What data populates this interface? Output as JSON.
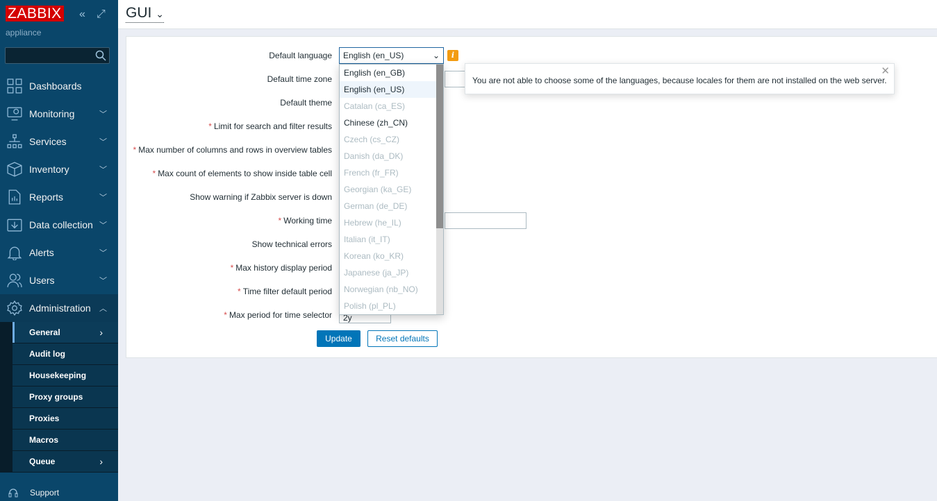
{
  "sidebar": {
    "logo": "ZABBIX",
    "subtitle": "appliance",
    "search_placeholder": "",
    "items": [
      {
        "label": "Dashboards",
        "icon": "dashboards-icon",
        "chevron": false
      },
      {
        "label": "Monitoring",
        "icon": "monitoring-icon",
        "chevron": true
      },
      {
        "label": "Services",
        "icon": "services-icon",
        "chevron": true
      },
      {
        "label": "Inventory",
        "icon": "inventory-icon",
        "chevron": true
      },
      {
        "label": "Reports",
        "icon": "reports-icon",
        "chevron": true
      },
      {
        "label": "Data collection",
        "icon": "data-collection-icon",
        "chevron": true
      },
      {
        "label": "Alerts",
        "icon": "alerts-icon",
        "chevron": true
      },
      {
        "label": "Users",
        "icon": "users-icon",
        "chevron": true
      },
      {
        "label": "Administration",
        "icon": "gear-icon",
        "chevron": true,
        "expanded": true
      }
    ],
    "submenu": [
      {
        "label": "General",
        "active": true,
        "arrow": true
      },
      {
        "label": "Audit log"
      },
      {
        "label": "Housekeeping"
      },
      {
        "label": "Proxy groups"
      },
      {
        "label": "Proxies"
      },
      {
        "label": "Macros"
      },
      {
        "label": "Queue",
        "arrow": true
      }
    ],
    "support": "Support"
  },
  "header": {
    "title": "GUI"
  },
  "form": {
    "fields": [
      {
        "label": "Default language",
        "required": false
      },
      {
        "label": "Default time zone",
        "required": false
      },
      {
        "label": "Default theme",
        "required": false
      },
      {
        "label": "Limit for search and filter results",
        "required": true
      },
      {
        "label": "Max number of columns and rows in overview tables",
        "required": true
      },
      {
        "label": "Max count of elements to show inside table cell",
        "required": true
      },
      {
        "label": "Show warning if Zabbix server is down",
        "required": false
      },
      {
        "label": "Working time",
        "required": true
      },
      {
        "label": "Show technical errors",
        "required": false
      },
      {
        "label": "Max history display period",
        "required": true
      },
      {
        "label": "Time filter default period",
        "required": true
      },
      {
        "label": "Max period for time selector",
        "required": true
      }
    ],
    "default_language": "English (en_US)",
    "max_period_value": "2y",
    "language_options": [
      {
        "label": "English (en_GB)",
        "enabled": true
      },
      {
        "label": "English (en_US)",
        "enabled": true,
        "selected": true
      },
      {
        "label": "Catalan (ca_ES)",
        "enabled": false
      },
      {
        "label": "Chinese (zh_CN)",
        "enabled": true
      },
      {
        "label": "Czech (cs_CZ)",
        "enabled": false
      },
      {
        "label": "Danish (da_DK)",
        "enabled": false
      },
      {
        "label": "French (fr_FR)",
        "enabled": false
      },
      {
        "label": "Georgian (ka_GE)",
        "enabled": false
      },
      {
        "label": "German (de_DE)",
        "enabled": false
      },
      {
        "label": "Hebrew (he_IL)",
        "enabled": false
      },
      {
        "label": "Italian (it_IT)",
        "enabled": false
      },
      {
        "label": "Korean (ko_KR)",
        "enabled": false
      },
      {
        "label": "Japanese (ja_JP)",
        "enabled": false
      },
      {
        "label": "Norwegian (nb_NO)",
        "enabled": false
      },
      {
        "label": "Polish (pl_PL)",
        "enabled": false
      }
    ],
    "tooltip": "You are not able to choose some of the languages, because locales for them are not installed on the web server.",
    "update_label": "Update",
    "reset_label": "Reset defaults"
  },
  "colors": {
    "sidebar": "#0a466a",
    "accent": "#0275b8",
    "logo": "#d40000",
    "info": "#f39c12"
  }
}
